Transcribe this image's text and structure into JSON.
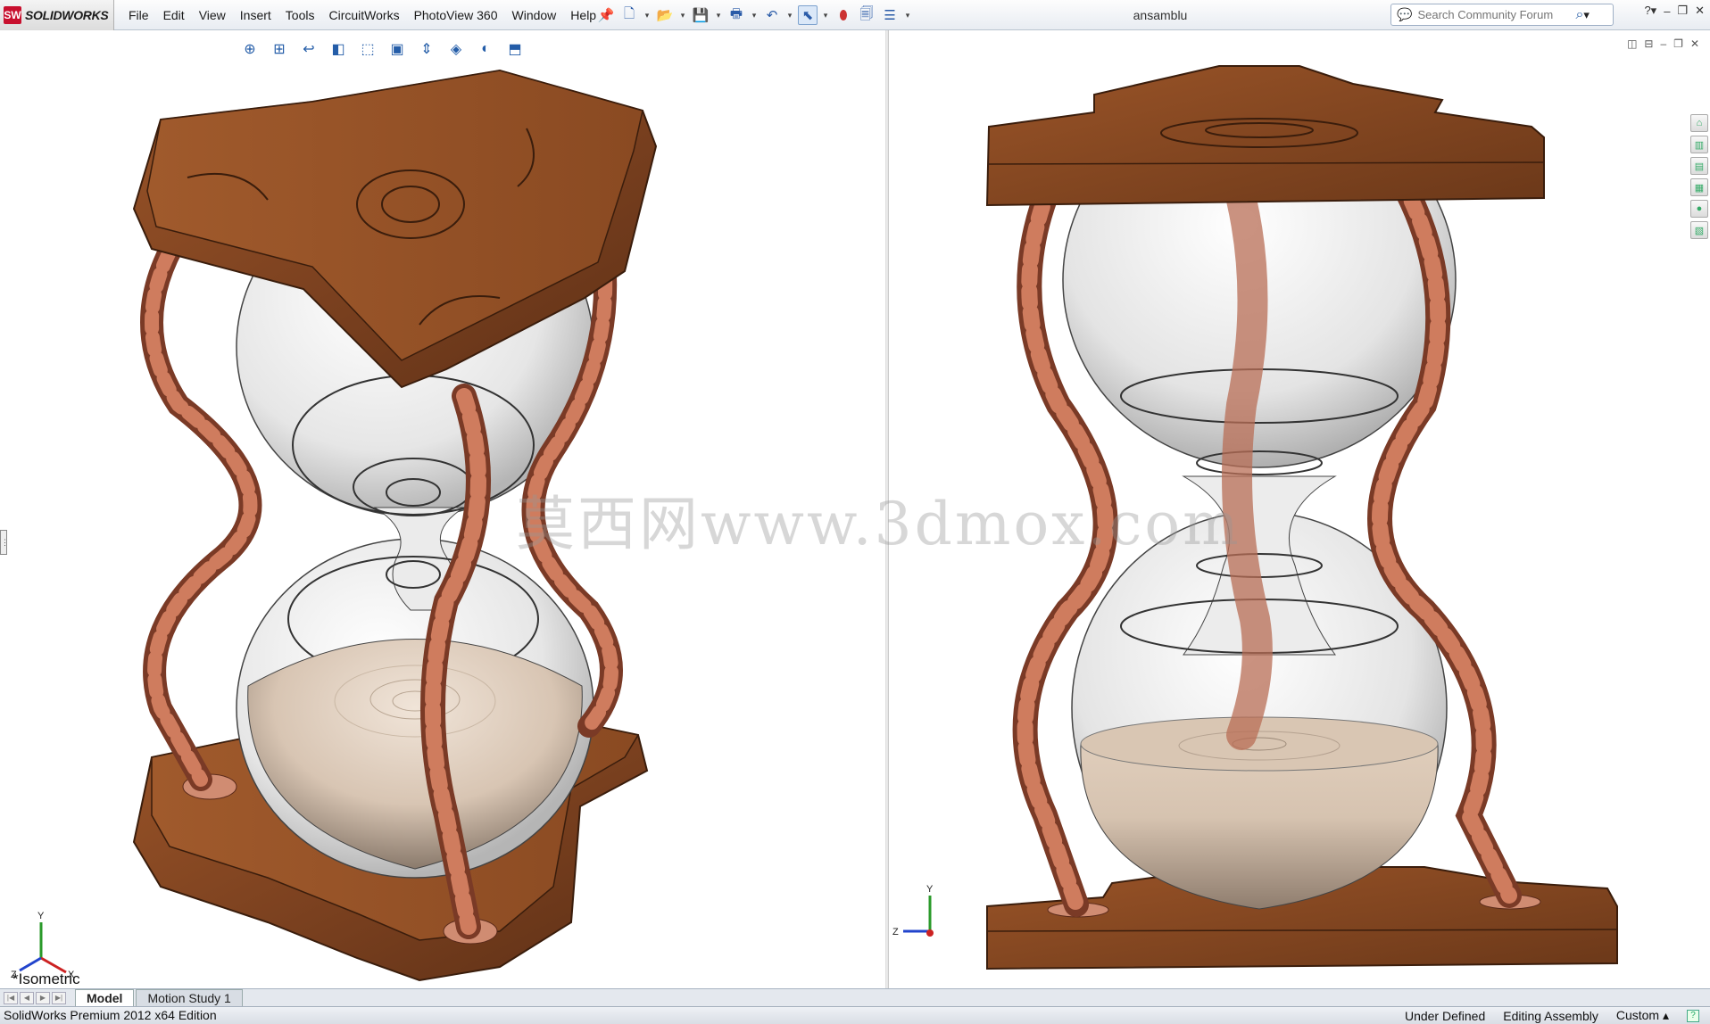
{
  "app": {
    "logo_mark": "SW",
    "logo_text": "SOLIDWORKS",
    "document_title": "ansamblu"
  },
  "menus": [
    "File",
    "Edit",
    "View",
    "Insert",
    "Tools",
    "CircuitWorks",
    "PhotoView 360",
    "Window",
    "Help"
  ],
  "quick_access_icons": [
    "pin-icon",
    "new-document-icon",
    "open-icon",
    "save-icon",
    "print-icon",
    "undo-icon",
    "select-arrow-icon",
    "rebuild-traffic-light-icon",
    "file-properties-icon",
    "options-icon"
  ],
  "search": {
    "placeholder": "Search Community Forum"
  },
  "window_controls": [
    "help-icon",
    "minimize-icon",
    "restore-icon",
    "close-icon"
  ],
  "viewport_left": {
    "label": "*Isometric",
    "hud_icons": [
      "zoom-to-fit-icon",
      "zoom-area-icon",
      "previous-view-icon",
      "section-view-icon",
      "view-orientation-icon",
      "display-style-icon",
      "hide-show-items-icon",
      "edit-appearance-icon",
      "apply-scene-icon",
      "view-settings-icon"
    ]
  },
  "viewport_right": {
    "viewport_controls": [
      "tile-horizontal-icon",
      "tile-vertical-icon",
      "minimize-icon",
      "restore-icon",
      "close-icon"
    ],
    "task_pane_icons": [
      "home-icon",
      "design-library-icon",
      "file-explorer-icon",
      "view-palette-icon",
      "appearances-icon",
      "custom-properties-icon"
    ]
  },
  "watermark": "莫西网www.3dmox.com",
  "tabs": [
    {
      "label": "Model",
      "active": true
    },
    {
      "label": "Motion Study 1",
      "active": false
    }
  ],
  "status": {
    "left": "SolidWorks Premium 2012 x64 Edition",
    "definition": "Under Defined",
    "mode": "Editing Assembly",
    "units": "Custom",
    "help": "?"
  },
  "colors": {
    "wood": "#8a4a22",
    "rope": "#c97458",
    "glass": "#e6e6e6",
    "sand": "#dccab8",
    "ui_bar": "#e8ecf2"
  }
}
